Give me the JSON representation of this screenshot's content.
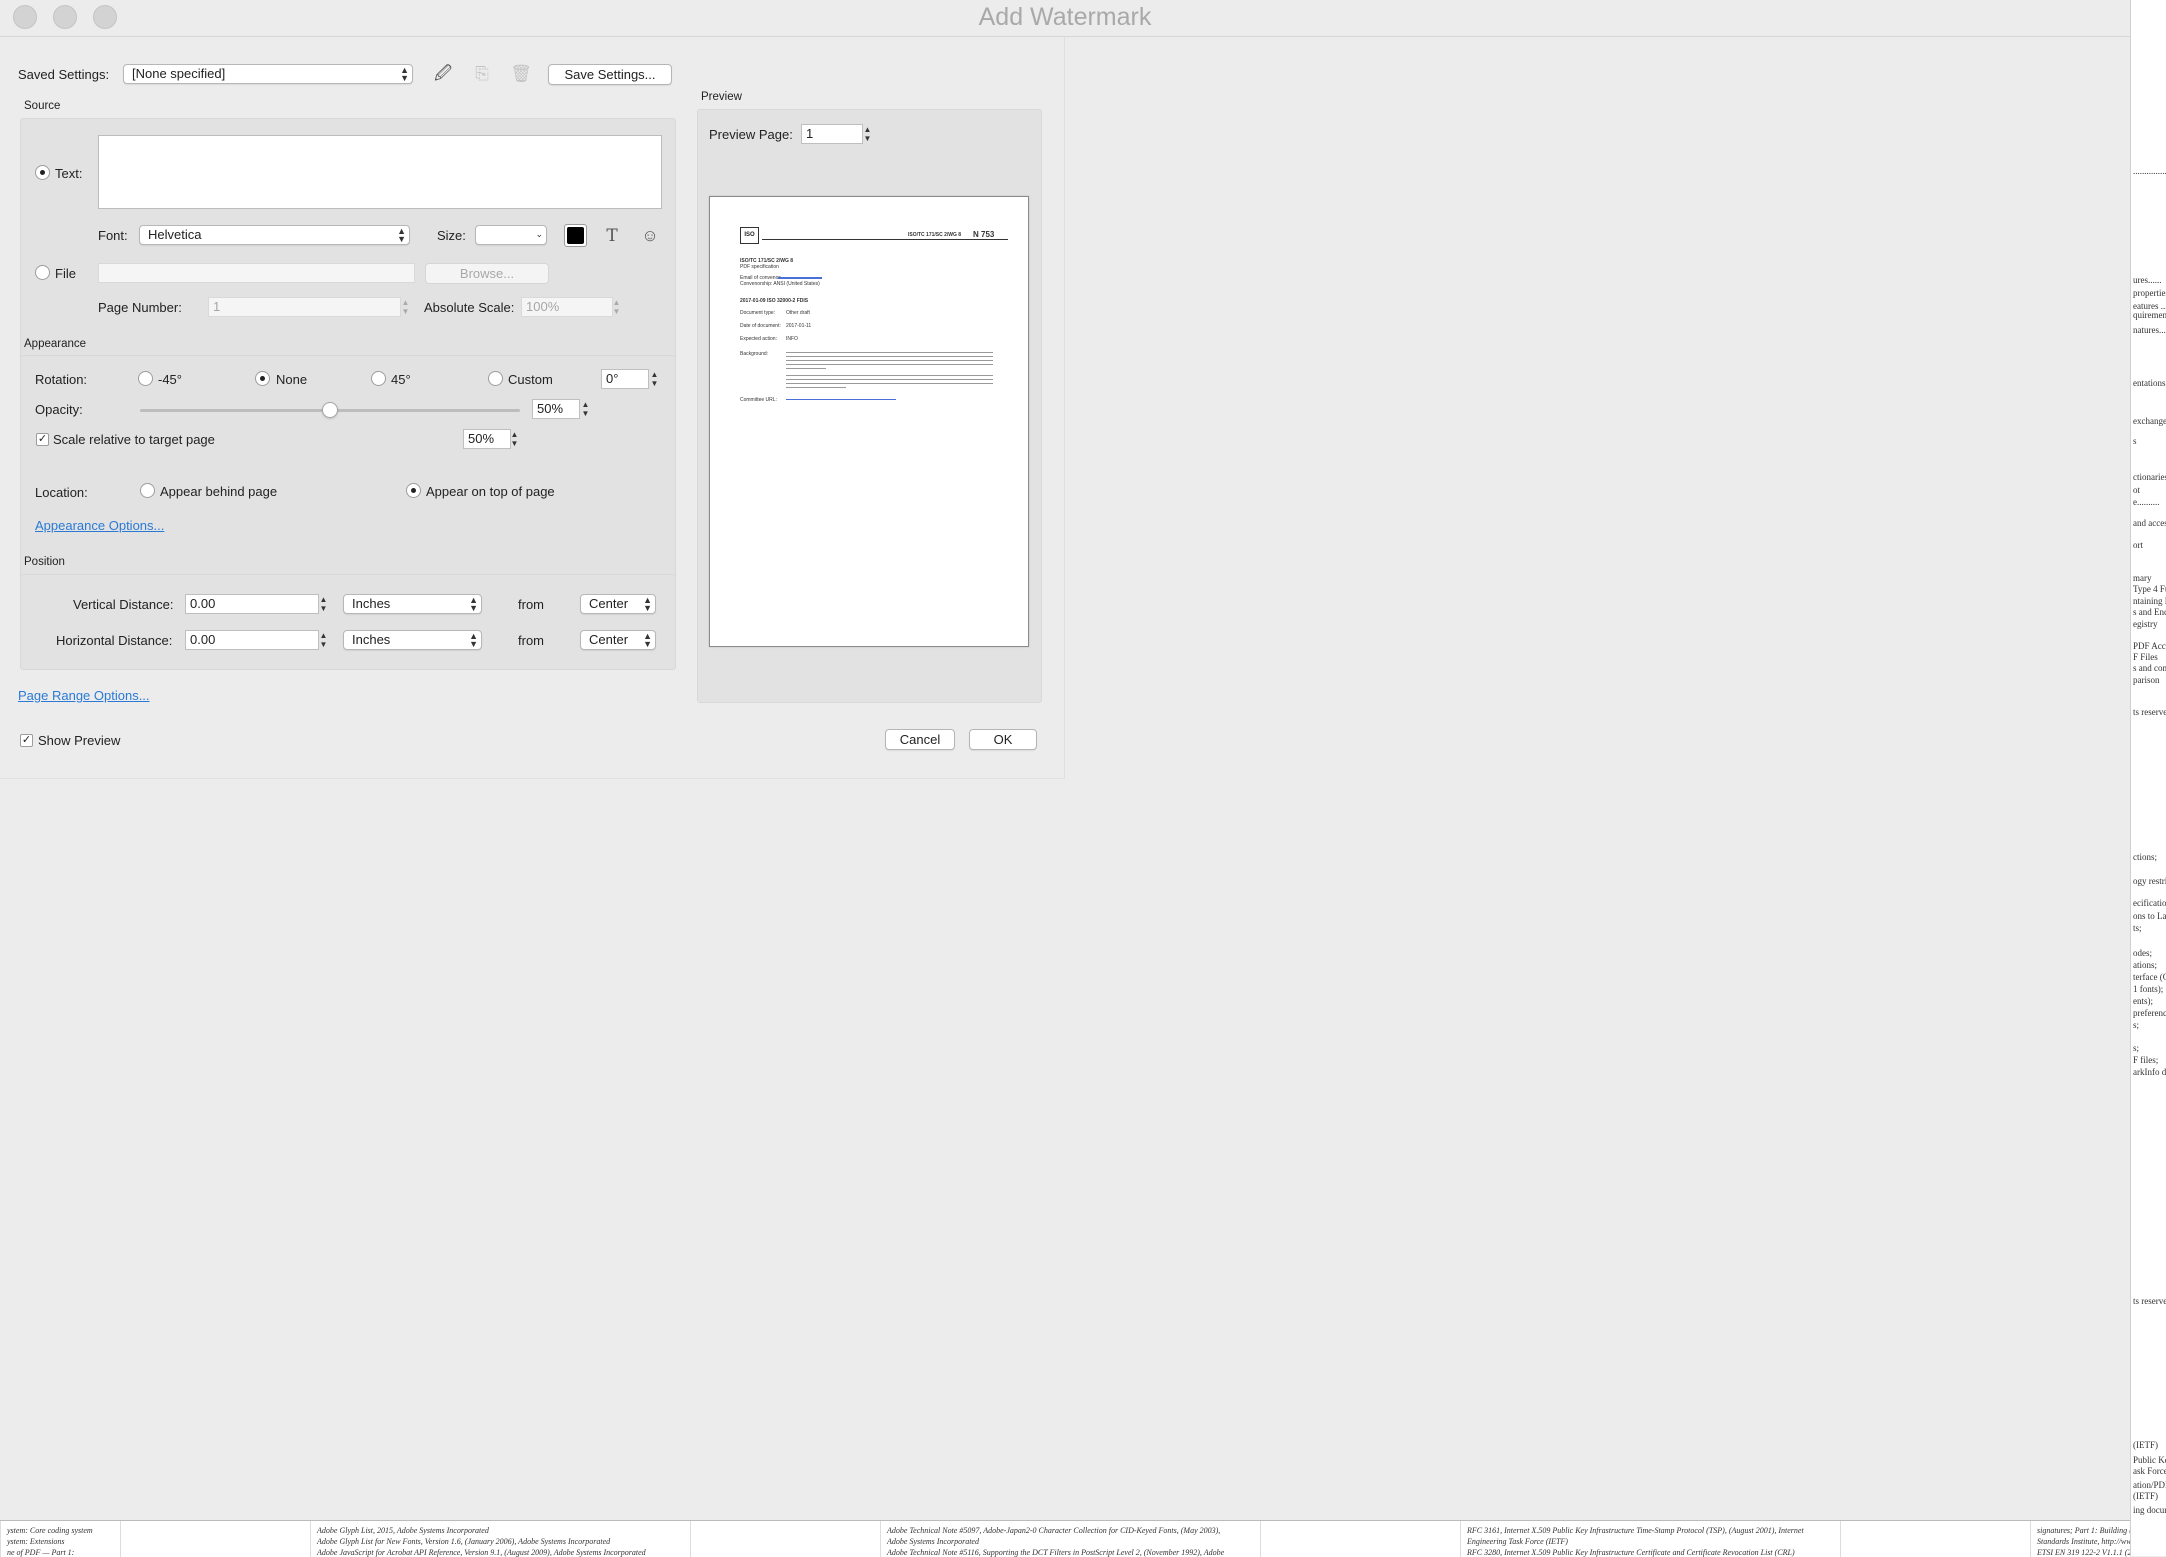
{
  "window": {
    "title": "Add Watermark"
  },
  "saved_settings": {
    "label": "Saved Settings:",
    "value": "[None specified]",
    "save_button": "Save Settings..."
  },
  "source": {
    "section_label": "Source",
    "text_option": "Text:",
    "text_value": "",
    "font_label": "Font:",
    "font_value": "Helvetica",
    "size_label": "Size:",
    "size_value": "",
    "text_color": "#000000",
    "file_option": "File",
    "file_path": "",
    "browse_button": "Browse...",
    "page_number_label": "Page Number:",
    "page_number_value": "1",
    "absolute_scale_label": "Absolute Scale:",
    "absolute_scale_value": "100%",
    "selected": "text"
  },
  "appearance": {
    "section_label": "Appearance",
    "rotation_label": "Rotation:",
    "rotation_options": [
      "-45°",
      "None",
      "45°",
      "Custom"
    ],
    "rotation_selected": "None",
    "custom_angle": "0°",
    "opacity_label": "Opacity:",
    "opacity_value": "50%",
    "opacity_fraction": 0.5,
    "scale_relative_label": "Scale relative to target page",
    "scale_relative_checked": true,
    "scale_value": "50%",
    "location_label": "Location:",
    "location_behind": "Appear behind page",
    "location_top": "Appear on top of page",
    "location_selected": "top",
    "options_link": "Appearance Options..."
  },
  "position": {
    "section_label": "Position",
    "vertical_label": "Vertical Distance:",
    "vertical_value": "0.00",
    "vertical_unit": "Inches",
    "vertical_from_label": "from",
    "vertical_from": "Center",
    "horizontal_label": "Horizontal Distance:",
    "horizontal_value": "0.00",
    "horizontal_unit": "Inches",
    "horizontal_from_label": "from",
    "horizontal_from": "Center"
  },
  "page_range_link": "Page Range Options...",
  "show_preview": {
    "label": "Show Preview",
    "checked": true
  },
  "preview": {
    "section_label": "Preview",
    "page_label": "Preview Page:",
    "page_value": "1",
    "doc": {
      "logo": "ISO",
      "header_right": "ISO/TC 171/SC 2/WG 8",
      "doc_number": "N 753",
      "line1": "ISO/TC 171/SC 2/WG 8",
      "line2": "PDF specification",
      "email_label": "Email of convenor:",
      "convenorship": "Convenorship: ANSI (United States)",
      "title_line": "2017-01-09 ISO 32000-2 FDIS",
      "rows": [
        {
          "k": "Document type:",
          "v": "Other draft"
        },
        {
          "k": "Date of document:",
          "v": "2017-01-11"
        },
        {
          "k": "Expected action:",
          "v": "INFO"
        }
      ],
      "background_label": "Background:",
      "committee_url_label": "Committee URL:"
    }
  },
  "buttons": {
    "cancel": "Cancel",
    "ok": "OK"
  }
}
